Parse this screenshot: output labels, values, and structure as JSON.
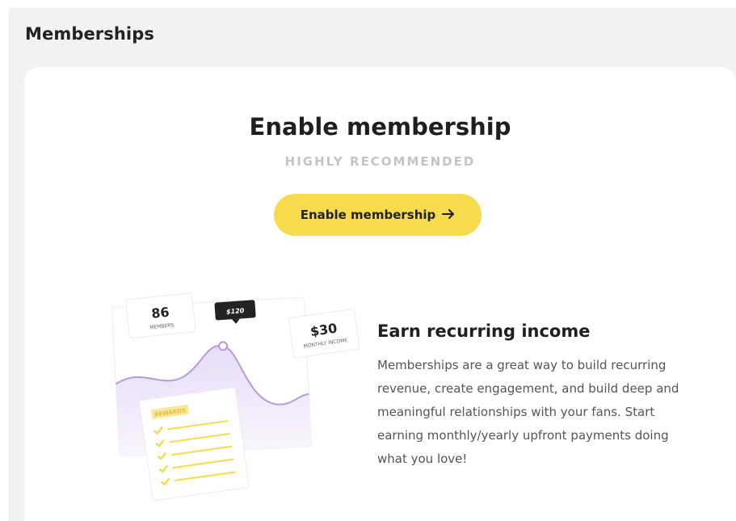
{
  "page": {
    "title": "Memberships"
  },
  "hero": {
    "title": "Enable membership",
    "subtitle": "HIGHLY RECOMMENDED",
    "button_label": "Enable membership",
    "button_icon": "arrow-right-icon"
  },
  "illustration": {
    "members_count": "86",
    "members_label": "MEMBERS",
    "tooltip_value": "$120",
    "monthly_value": "$30",
    "monthly_label": "MONTHLY INCOME",
    "rewards_label": "REWARDS",
    "checklist_items": 5
  },
  "feature": {
    "title": "Earn recurring income",
    "description": "Memberships are a great way to build recurring revenue, create engagement, and build deep and meaningful relationships with your fans. Start earning monthly/yearly upfront payments doing what you love!"
  },
  "colors": {
    "accent": "#f6db4d",
    "page_bg": "#f1f2f4",
    "chart_line": "#b49ae0",
    "chart_fill": "#efe8fb"
  }
}
